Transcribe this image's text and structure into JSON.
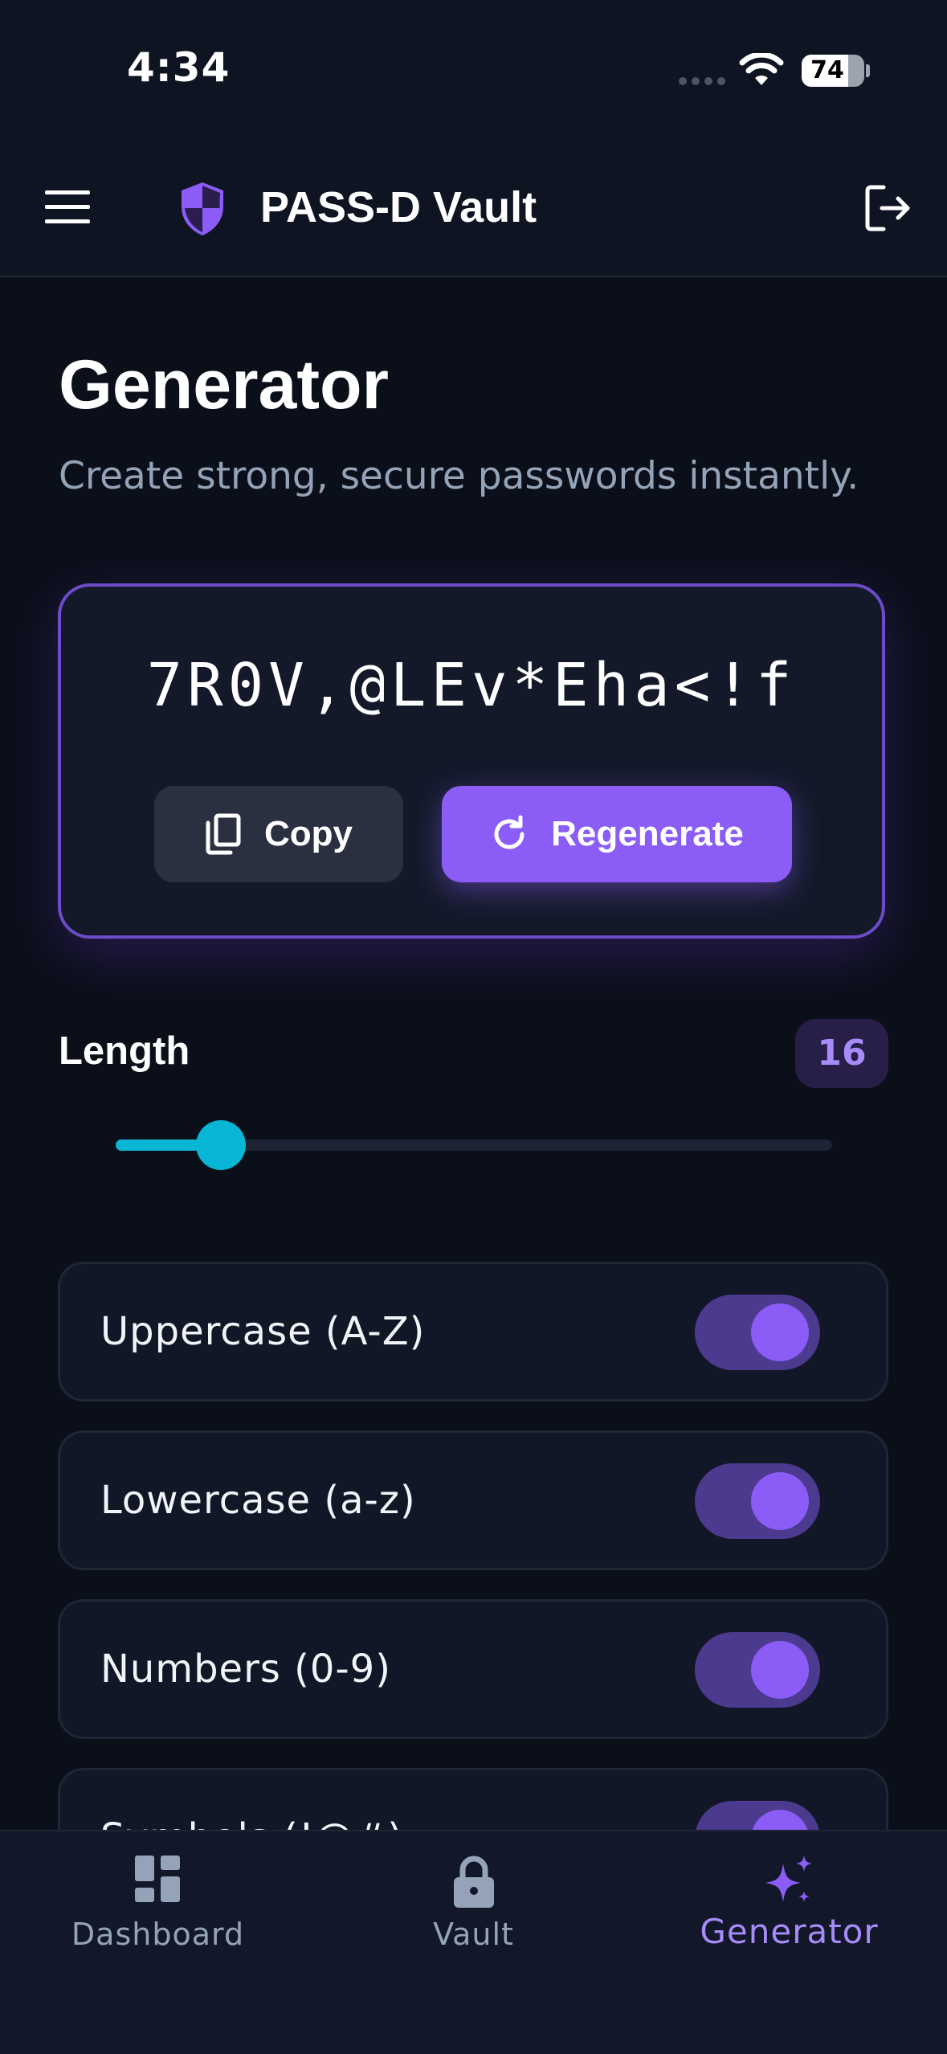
{
  "status_bar": {
    "time": "4:34",
    "battery": "74",
    "battery_level": 0.74
  },
  "header": {
    "title": "PASS-D Vault",
    "icons": {
      "menu": "menu-icon",
      "logo": "shield-icon",
      "logout": "logout-icon"
    }
  },
  "page": {
    "title": "Generator",
    "subtitle": "Create strong, secure passwords instantly."
  },
  "generator": {
    "password": "7R0V,@LEv*Eha<!f",
    "copy_label": "Copy",
    "regenerate_label": "Regenerate"
  },
  "length": {
    "label": "Length",
    "value": "16",
    "slider_fraction": 0.147
  },
  "options": [
    {
      "label": "Uppercase (A-Z)",
      "enabled": true
    },
    {
      "label": "Lowercase (a-z)",
      "enabled": true
    },
    {
      "label": "Numbers (0-9)",
      "enabled": true
    },
    {
      "label": "Symbols (!@#)",
      "enabled": true
    }
  ],
  "bottom_nav": {
    "items": [
      {
        "label": "Dashboard",
        "icon": "dashboard-icon",
        "active": false
      },
      {
        "label": "Vault",
        "icon": "lock-icon",
        "active": false
      },
      {
        "label": "Generator",
        "icon": "sparkles-icon",
        "active": true
      }
    ]
  },
  "colors": {
    "accent": "#8b5cf6",
    "slider": "#06b6d4",
    "background": "#0b0f19"
  }
}
